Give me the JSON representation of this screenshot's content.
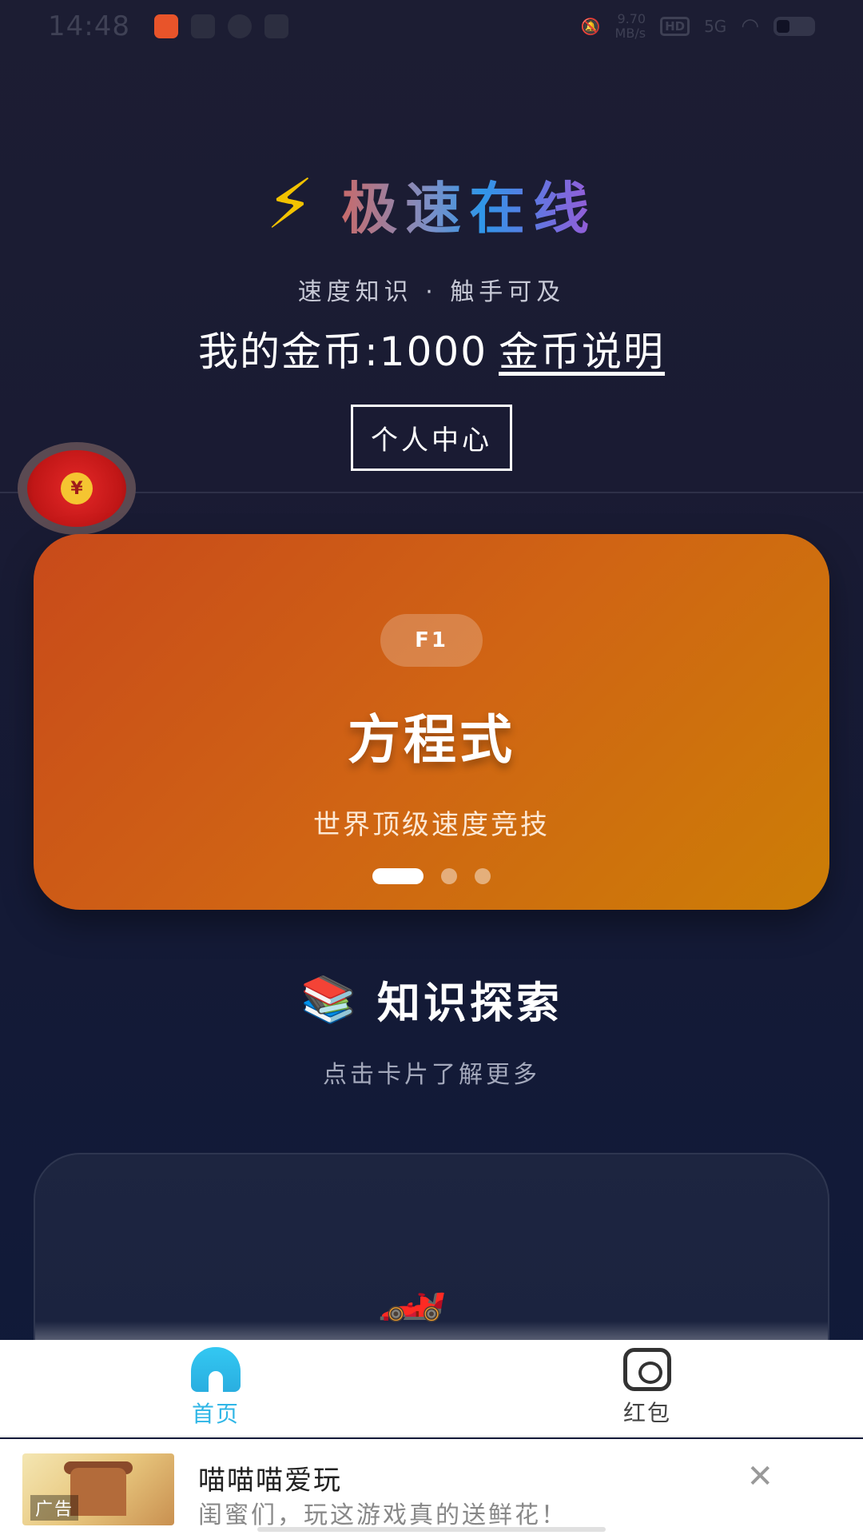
{
  "status_bar": {
    "time": "14:48",
    "net_speed_value": "9.70",
    "net_speed_unit": "MB/s",
    "hd": "HD",
    "signal": "5G"
  },
  "header": {
    "bolt_icon": "⚡",
    "title": "极速在线",
    "subtitle": "速度知识 · 触手可及",
    "coins_label": "我的金币:1000",
    "coins_help_link": "金币说明",
    "personal_center_button": "个人中心"
  },
  "red_packet": {
    "coin_symbol": "¥"
  },
  "banner": {
    "tag": "F1",
    "title": "方程式",
    "subtitle": "世界顶级速度竞技",
    "page_count": 3,
    "active_page": 1
  },
  "section": {
    "icon": "📚",
    "title": "知识探索",
    "subtitle": "点击卡片了解更多"
  },
  "card": {
    "icon": "🏎️"
  },
  "tabbar": {
    "home_label": "首页",
    "redpacket_label": "红包"
  },
  "ad": {
    "badge": "广告",
    "title": "喵喵喵爱玩",
    "description": "闺蜜们，玩这游戏真的送鲜花！",
    "close": "✕"
  }
}
